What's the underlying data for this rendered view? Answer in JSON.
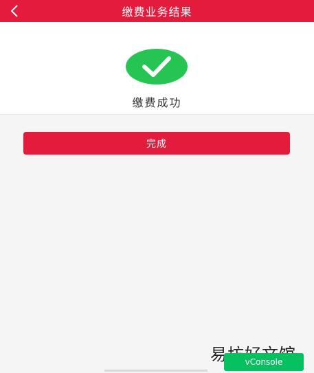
{
  "nav": {
    "title": "缴费业务结果",
    "back_icon": "chevron-left-icon"
  },
  "result": {
    "icon": "checkmark-icon",
    "status_text": "缴费成功"
  },
  "actions": {
    "done_label": "完成"
  },
  "vconsole": {
    "label": "vConsole"
  },
  "watermark": {
    "text": "易坊好文馆"
  },
  "colors": {
    "brand_red": "#e31c3d",
    "success_green": "#26c453",
    "vconsole_green": "#07c160"
  }
}
